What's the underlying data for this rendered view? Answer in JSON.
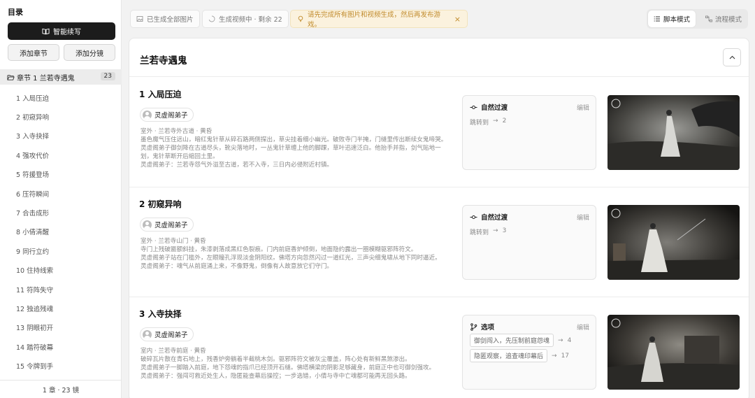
{
  "sidebar": {
    "title": "目录",
    "smart_continue": "智能续写",
    "add_chapter": "添加章节",
    "add_shot": "添加分镜",
    "chapter": {
      "label": "章节 1 兰若寺遇鬼",
      "count": "23"
    },
    "items": [
      "1 入局压迫",
      "2 初窥异响",
      "3 入寺抉择",
      "4 强攻代价",
      "5 符援登场",
      "6 压符瞬间",
      "7 合击成形",
      "8 小倩清醒",
      "9 同行立约",
      "10 住持线索",
      "11 符阵失守",
      "12 独追残魂",
      "13 阴眼初开",
      "14 踏符破幕",
      "15 令牌到手"
    ],
    "footer": "1 章 · 23 镜"
  },
  "topbar": {
    "generated_all": "已生成全部图片",
    "video_status": "生成视频中 · 剩余 22",
    "warning": "请先完成所有图片和视频生成，然后再发布游戏。",
    "warning_close": "×",
    "mode_script": "脚本模式",
    "mode_flow": "流程模式"
  },
  "main": {
    "title": "兰若寺遇鬼",
    "scenes": [
      {
        "title": "1 入局压迫",
        "character": "灵虚阁弟子",
        "lines": [
          "室外 · 兰若寺外古道 · 黄昏",
          "墨色魔气压住远山，暗红鬼针草从碎石路两侧探出，草尖挂着细小幽光。破败寺门半掩，门缝里传出断续女鬼啼哭。",
          "灵虚阁弟子御剑降在古道尽头，靴尖落地时，一丛鬼针草缠上他的脚踝，草叶迅速泛白。他抬手并指，剑气贴地一划，鬼针草断开后缩回土里。",
          "灵虚阁弟子：兰若寺怨气外溢至古道，若不入寺，三日内必侵附近村镇。"
        ],
        "transition": {
          "type": "自然过渡",
          "edit": "编辑",
          "jump_label": "跳转到",
          "arrow": "→",
          "target": "2"
        }
      },
      {
        "title": "2 初窥异响",
        "character": "灵虚阁弟子",
        "lines": [
          "室外 · 兰若寺山门 · 黄昏",
          "寺门上残破匾额斜挂，朱漆剥落成黑红色裂痕。门内前庭香炉倾倒，地面隐约露出一圈模糊驱邪阵符文。",
          "灵虚阁弟子站在门槛外，左眼瞳孔浮现淡金阴阳纹。佛塔方向忽然闪过一道红光，三声尖细鬼啸从地下同时逼近。",
          "灵虚阁弟子：魂气从前庭涌上来，不像野鬼，倒像有人故意放它们守门。"
        ],
        "transition": {
          "type": "自然过渡",
          "edit": "编辑",
          "jump_label": "跳转到",
          "arrow": "→",
          "target": "3"
        }
      },
      {
        "title": "3 入寺抉择",
        "character": "灵虚阁弟子",
        "lines": [
          "室内 · 兰若寺前庭 · 黄昏",
          "破碎瓦片散在青石地上，残香炉旁躺着半截桃木剑。驱邪阵符文被灰尘覆盖，阵心处有新鲜黑煞渗出。",
          "灵虚阁弟子一脚踏入前庭，地下怨魂的指爪已经顶开石缝。佛塔横梁的阴影足够藏身，前庭正中也可御剑强攻。",
          "灵虚阁弟子：强闯可救近处生人，隐匿能查幕后操控；一步选错，小倩与寺中亡魂都可能再无回头路。"
        ],
        "choices": {
          "type": "选项",
          "edit": "编辑",
          "options": [
            {
              "label": "御剑闯入，先压制前庭怨魂",
              "arrow": "→",
              "target": "4"
            },
            {
              "label": "隐匿观察，追查魂印幕后",
              "arrow": "→",
              "target": "17"
            }
          ]
        }
      }
    ]
  }
}
